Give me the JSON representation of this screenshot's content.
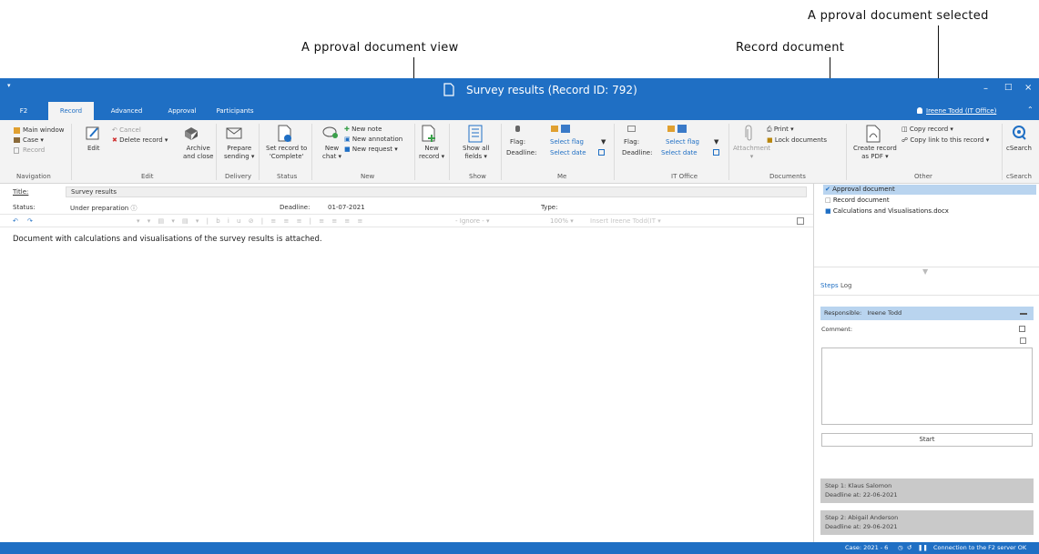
{
  "annotations": {
    "approval_view": "A pproval document view",
    "record_document": "Record document",
    "approval_selected": "A pproval document selected"
  },
  "window": {
    "title": "Survey results (Record ID: 792)",
    "user": "Ireene Todd (IT Office)"
  },
  "tabs": [
    "F2",
    "Record",
    "Advanced",
    "Approval",
    "Participants"
  ],
  "ribbon": {
    "main_window": "Main window",
    "case": "Case",
    "record": "Record",
    "navigation": "Navigation",
    "edit": "Edit",
    "cancel": "Cancel",
    "delete_record": "Delete record",
    "archive_close_1": "Archive",
    "archive_close_2": "and close",
    "edit_group": "Edit",
    "prepare_1": "Prepare",
    "prepare_2": "sending",
    "delivery": "Delivery",
    "set_record_1": "Set record to",
    "set_record_2": "'Complete'",
    "status": "Status",
    "new_chat_1": "New",
    "new_chat_2": "chat",
    "new_note": "New note",
    "new_annotation": "New annotation",
    "new_request": "New request",
    "new_group": "New",
    "new_record_1": "New",
    "new_record_2": "record",
    "show_all_1": "Show all",
    "show_all_2": "fields",
    "show": "Show",
    "flag": "Flag:",
    "select_flag": "Select flag",
    "deadline": "Deadline:",
    "select_date": "Select date",
    "me": "Me",
    "flag2": "Flag:",
    "select_flag2": "Select flag",
    "deadline2": "Deadline:",
    "select_date2": "Select date",
    "it_office": "IT Office",
    "attachment": "Attachment",
    "print": "Print",
    "lock_documents": "Lock documents",
    "documents": "Documents",
    "create_pdf_1": "Create record",
    "create_pdf_2": "as PDF",
    "copy_record": "Copy record",
    "copy_link": "Copy link to this record",
    "other": "Other",
    "csearch": "cSearch",
    "csearch_group": "cSearch"
  },
  "fields": {
    "title_label": "Title:",
    "title_value": "Survey results",
    "status_label": "Status:",
    "status_value": "Under preparation",
    "deadline_label": "Deadline:",
    "deadline_value": "01-07-2021",
    "type_label": "Type:"
  },
  "toolbar": {
    "ignore": "- Ignore -",
    "zoom": "100%",
    "insert": "Insert Ireene Todd(IT"
  },
  "document": {
    "body": "Document with calculations and visualisations of the survey results is attached."
  },
  "documents": [
    {
      "label": "Approval document",
      "selected": true
    },
    {
      "label": "Record document",
      "selected": false
    },
    {
      "label": "Calculations and Visualisations.docx",
      "selected": false
    }
  ],
  "steps": {
    "tab_steps": "Steps",
    "tab_log": "Log",
    "responsible_label": "Responsible:",
    "responsible_value": "Ireene Todd",
    "comment_label": "Comment:",
    "start": "Start",
    "step1_line1": "Step 1:   Klaus Salomon",
    "step1_line2": "Deadline at: 22-06-2021",
    "step2_line1": "Step 2:   Abigail Anderson",
    "step2_line2": "Deadline at: 29-06-2021"
  },
  "statusbar": {
    "case": "Case: 2021 - 6",
    "connection": "Connection to the F2 server OK"
  },
  "colors": {
    "accent": "#1f6fc4",
    "selection": "#b9d4ef",
    "card": "#c9c9c9"
  }
}
